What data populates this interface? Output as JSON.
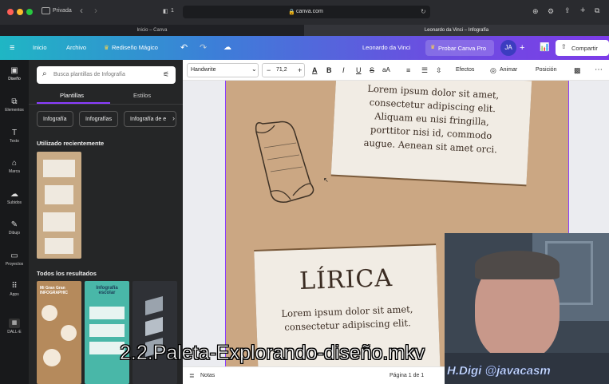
{
  "browser": {
    "private_label": "Privada",
    "tab_count": "1",
    "address": "canva.com",
    "tabs": [
      {
        "label": "Inicio – Canva"
      },
      {
        "label": "Leonardo da Vinci – Infografía"
      }
    ]
  },
  "topbar": {
    "inicio": "Inicio",
    "archivo": "Archivo",
    "magic": "Rediseño Mágico",
    "doc_title": "Leonardo da Vinci",
    "pro": "Probar Canva Pro",
    "avatar": "JA",
    "share": "Compartir"
  },
  "rail": [
    {
      "label": "Diseño",
      "icon": "layout-icon"
    },
    {
      "label": "Elementos",
      "icon": "shapes-icon"
    },
    {
      "label": "Texto",
      "icon": "text-icon"
    },
    {
      "label": "Marca",
      "icon": "brand-icon"
    },
    {
      "label": "Subidos",
      "icon": "upload-icon"
    },
    {
      "label": "Dibujo",
      "icon": "draw-icon"
    },
    {
      "label": "Proyectos",
      "icon": "folder-icon"
    },
    {
      "label": "Apps",
      "icon": "apps-icon"
    },
    {
      "label": "DALL-E",
      "icon": "dalle-icon"
    }
  ],
  "panel": {
    "search_placeholder": "Busca plantillas de Infografía",
    "tab_templates": "Plantillas",
    "tab_styles": "Estilos",
    "chips": [
      "Infografía",
      "Infografías",
      "Infografía de e"
    ],
    "recent_heading": "Utilizado recientemente",
    "all_heading": "Todos los resultados",
    "results": [
      {
        "title": "Mi Gran Gran INFOGRAPHIC"
      },
      {
        "title": "Infografía escolar"
      },
      {
        "title": ""
      }
    ]
  },
  "editor": {
    "font": "Handwrite",
    "font_size": "71,2",
    "effects": "Efectos",
    "animate": "Animar",
    "position": "Posición"
  },
  "canvas": {
    "paragraph1": "Lorem ipsum dolor sit amet, consectetur adipiscing elit. Aliquam eu nisi fringilla, porttitor nisi id, commodo augue. Aenean sit amet orci.",
    "heading2": "LÍRICA",
    "paragraph2": "Lorem ipsum dolor sit amet, consectetur adipiscing elit."
  },
  "bottom": {
    "notes": "Notas",
    "page": "Página 1 de 1"
  },
  "overlay": {
    "subtitle": "2.2.Paleta-Explorando-diseño.mkv",
    "watermark": "H.Digi  @javacasm"
  },
  "colors": {
    "accent": "#8b3dff",
    "brand_start": "#1fb6c4",
    "brand_end": "#7d3ce8"
  }
}
